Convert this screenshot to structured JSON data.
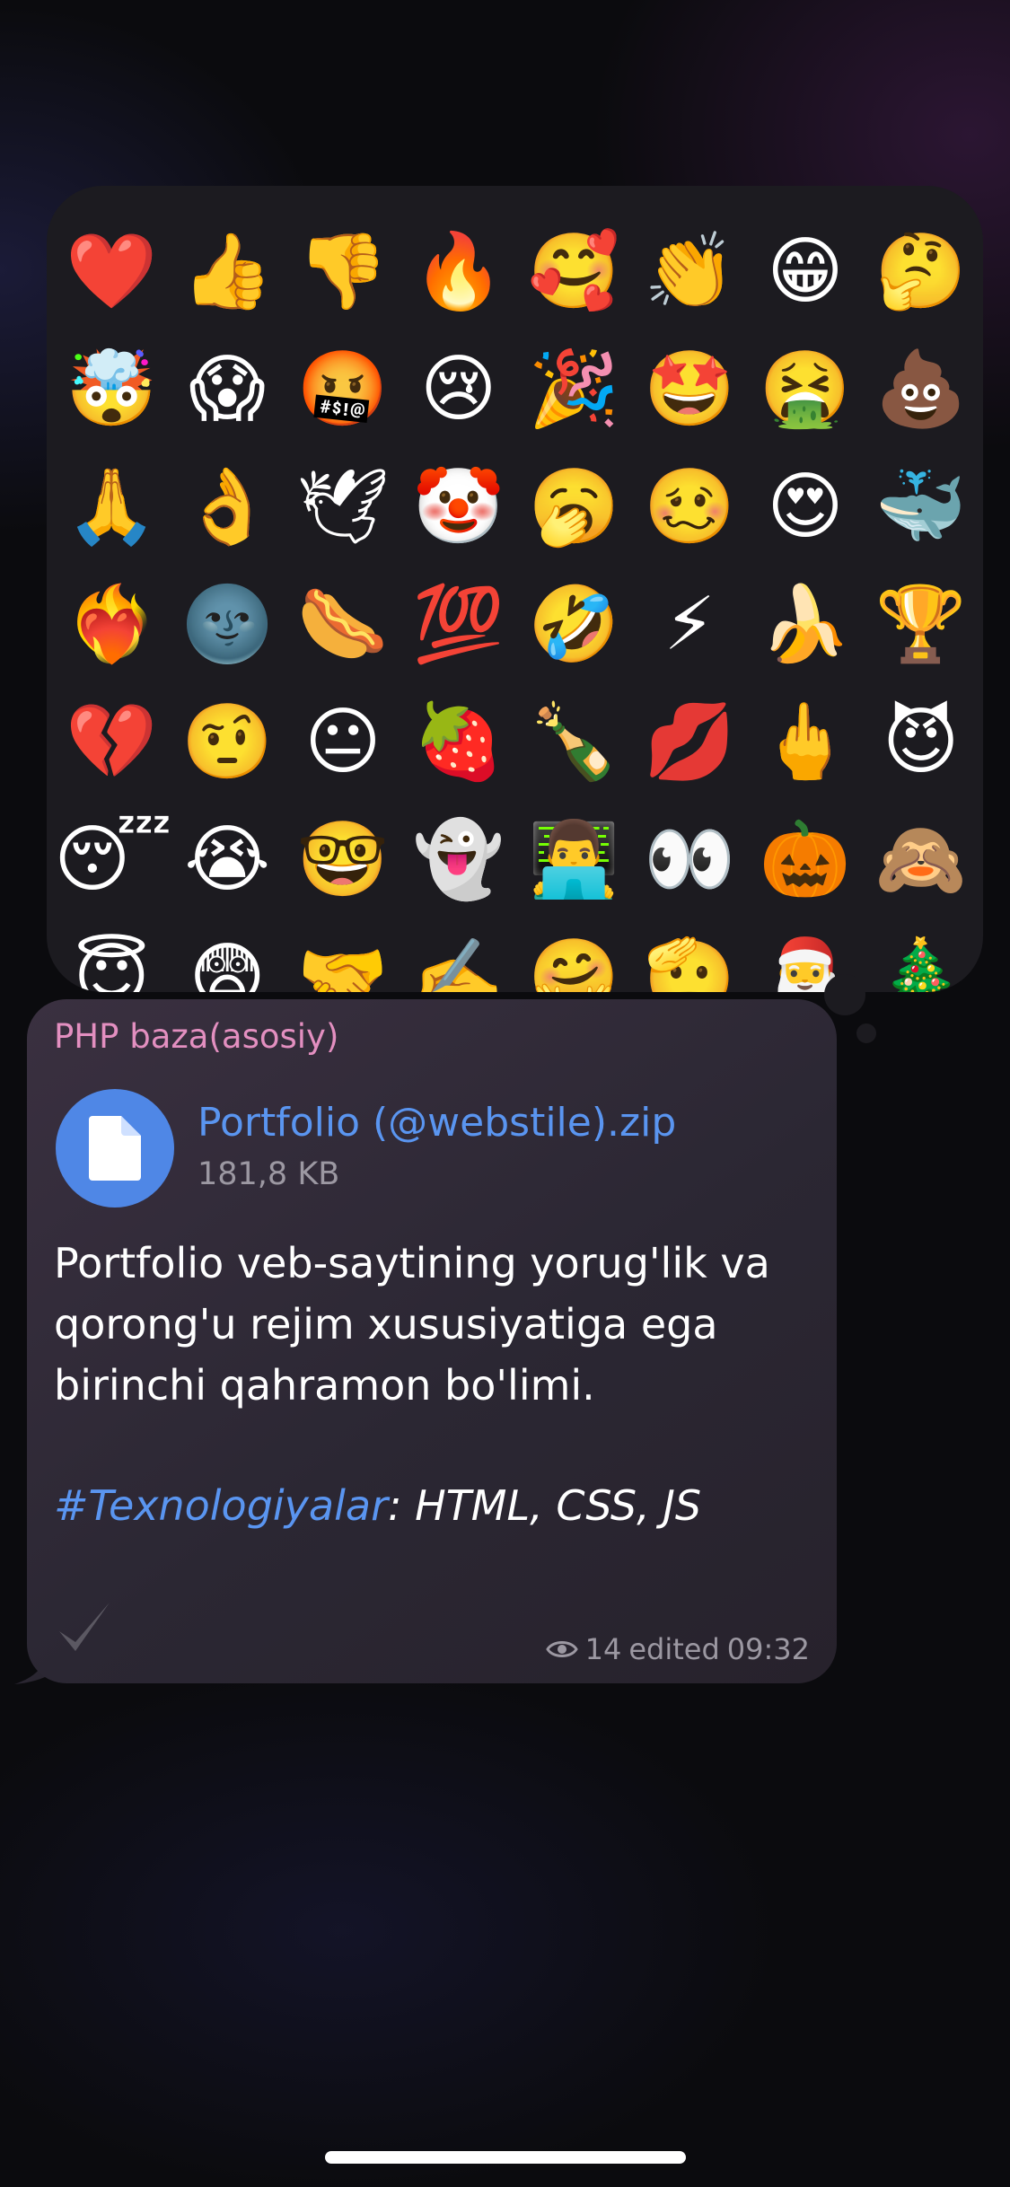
{
  "reactions": [
    "❤️",
    "👍",
    "👎",
    "🔥",
    "🥰",
    "👏",
    "😁",
    "🤔",
    "🤯",
    "😱",
    "🤬",
    "😢",
    "🎉",
    "🤩",
    "🤮",
    "💩",
    "🙏",
    "👌",
    "🕊",
    "🤡",
    "🥱",
    "🥴",
    "😍",
    "🐳",
    "❤️‍🔥",
    "🌚",
    "🌭",
    "💯",
    "🤣",
    "⚡",
    "🍌",
    "🏆",
    "💔",
    "🤨",
    "😐",
    "🍓",
    "🍾",
    "💋",
    "🖕",
    "😈",
    "😴",
    "😭",
    "🤓",
    "👻",
    "👨‍💻",
    "👀",
    "🎃",
    "🙈",
    "😇",
    "😨",
    "🤝",
    "✍️",
    "🤗",
    "🫡",
    "🎅",
    "🎄"
  ],
  "message": {
    "sender": "PHP baza(asosiy)",
    "file": {
      "name": "Portfolio (@webstile).zip",
      "size": "181,8 KB",
      "icon": "file-icon"
    },
    "text_lines": [
      "Portfolio veb-saytining yorug'lik va",
      "qorong'u rejim xususiyatiga ega",
      "birinchi qahramon bo'limi."
    ],
    "hashtag": "#Texnologiyalar",
    "technologies": ": HTML, CSS, JS",
    "views": "14",
    "edited_label": "edited",
    "time": "09:32",
    "colors": {
      "sender": "#e38fc0",
      "link": "#5a95f0",
      "file_icon_bg": "#4f87e6",
      "meta": "#9c98a2"
    }
  }
}
